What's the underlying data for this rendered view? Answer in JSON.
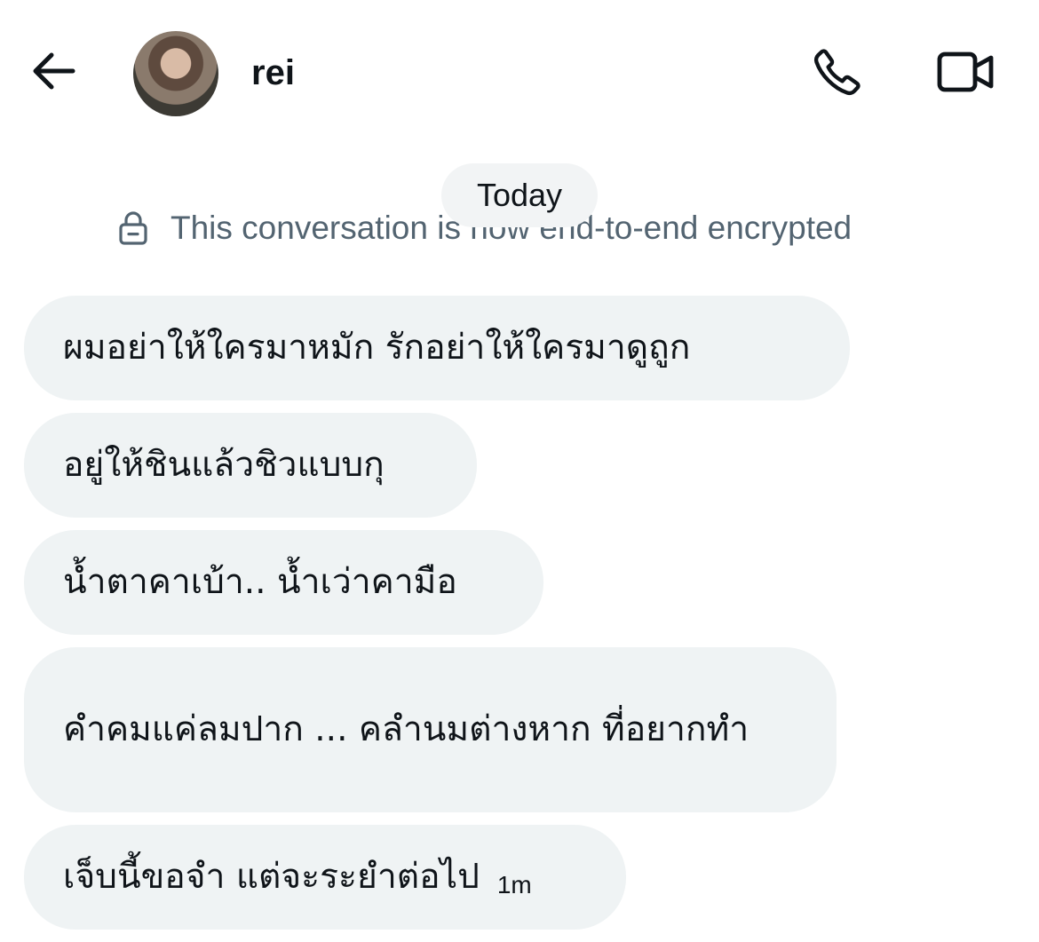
{
  "header": {
    "back_icon": "arrow-left-icon",
    "contact_name": "rei",
    "call_icon": "phone-icon",
    "video_icon": "video-camera-icon"
  },
  "conversation": {
    "date_label": "Today",
    "encryption_notice": "This conversation is now end-to-end encrypted",
    "messages": [
      {
        "text": "ผมอย่าให้ใครมาหมัก รักอย่าให้ใครมาดูถูก"
      },
      {
        "text": "อยู่ให้ชินแล้วชิวแบบกุ"
      },
      {
        "text": "น้ำตาคาเบ้า.. น้ำเว่าคามือ"
      },
      {
        "text": "คำคมแค่ลมปาก ... คลำนมต่างหาก ที่อยากทำ"
      },
      {
        "text": "เจ็บนี้ขอจำ แต่จะระยำต่อไป",
        "time": "1m"
      }
    ]
  },
  "colors": {
    "bubble_bg": "#eff3f4",
    "text": "#0f1419",
    "muted_text": "#536471"
  }
}
